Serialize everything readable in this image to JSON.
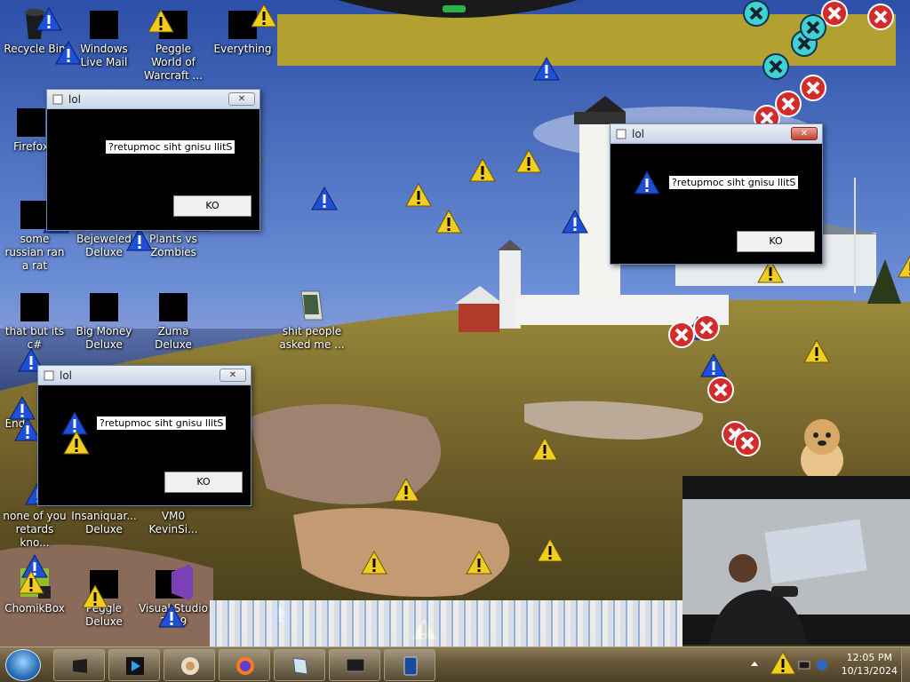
{
  "desktop": {
    "icons": [
      {
        "label": "Recycle Bin",
        "name": "recycle-bin"
      },
      {
        "label": "Windows Live Mail",
        "name": "windows-live-mail"
      },
      {
        "label": "Peggle World of Warcraft ...",
        "name": "peggle-wow"
      },
      {
        "label": "Everything",
        "name": "everything"
      },
      {
        "label": "Firefox",
        "name": "firefox"
      },
      {
        "label": "some russian ran a rat",
        "name": "some-russian-ran-a-rat"
      },
      {
        "label": "Bejeweled Deluxe",
        "name": "bejeweled-deluxe"
      },
      {
        "label": "Plants vs Zombies",
        "name": "plants-vs-zombies"
      },
      {
        "label": "that but its c#",
        "name": "that-but-its-csharp"
      },
      {
        "label": "Big Money Deluxe",
        "name": "big-money-deluxe"
      },
      {
        "label": "Zuma Deluxe",
        "name": "zuma-deluxe"
      },
      {
        "label": "shit people asked me ...",
        "name": "shit-people-asked-me"
      },
      {
        "label": "End",
        "name": "end"
      },
      {
        "label": "none of you retards kno...",
        "name": "none-of-you"
      },
      {
        "label": "Insaniquar... Deluxe",
        "name": "insaniquarium-deluxe"
      },
      {
        "label": "VM0 KevinSi...",
        "name": "vm0-kevinsi"
      },
      {
        "label": "ChomikBox",
        "name": "chomikbox"
      },
      {
        "label": "Peggle Deluxe",
        "name": "peggle-deluxe"
      },
      {
        "label": "Visual Studio 2019",
        "name": "visual-studio"
      }
    ]
  },
  "dialogs": [
    {
      "title": "lol",
      "message": "?retupmoc siht gnisu llitS",
      "ok_label": "KO",
      "close_label": "✕"
    },
    {
      "title": "lol",
      "message": "?retupmoc siht gnisu llitS",
      "ok_label": "KO",
      "close_label": "✕"
    },
    {
      "title": "lol",
      "message": "?retupmoc siht gnisu llitS",
      "ok_label": "KO",
      "close_label": "✕"
    }
  ],
  "taskbar": {
    "clock_time": "12:05 PM",
    "clock_date": "10/13/2024",
    "pinned": [
      "media-center-icon",
      "media-player-icon",
      "orb-app-icon",
      "firefox-icon",
      "notepad-icon",
      "monitor-icon",
      "tablet-icon"
    ]
  },
  "colors": {
    "warning": "#f2cc1f",
    "info": "#1d4fd8",
    "error": "#d22b2b",
    "taskbar": "#6a5a3c"
  }
}
